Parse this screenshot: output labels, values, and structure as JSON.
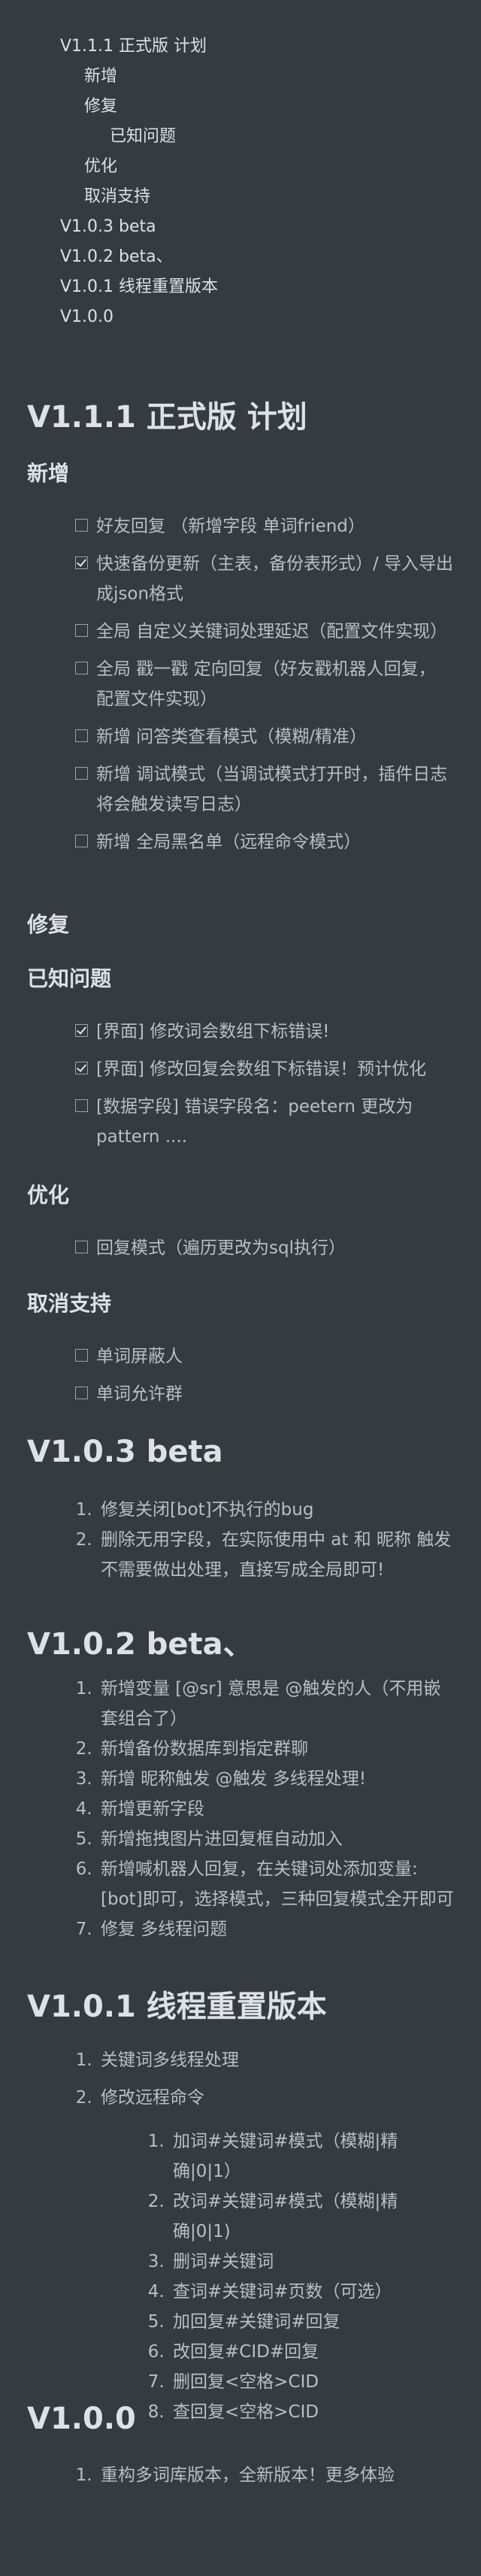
{
  "toc": [
    {
      "label": "V1.1.1 正式版 计划",
      "level": 1
    },
    {
      "label": "新增",
      "level": 2
    },
    {
      "label": "修复",
      "level": 2
    },
    {
      "label": "已知问题",
      "level": 3
    },
    {
      "label": "优化",
      "level": 2
    },
    {
      "label": "取消支持",
      "level": 2
    },
    {
      "label": "V1.0.3 beta",
      "level": 1
    },
    {
      "label": "V1.0.2 beta、",
      "level": 1
    },
    {
      "label": "V1.0.1 线程重置版本",
      "level": 1
    },
    {
      "label": "V1.0.0",
      "level": 1
    }
  ],
  "v111": {
    "title": "V1.1.1 正式版 计划",
    "added": {
      "heading": "新增",
      "items": [
        {
          "checked": false,
          "text": "好友回复 （新增字段 单词friend）"
        },
        {
          "checked": true,
          "text": "快速备份更新（主表，备份表形式）/ 导入导出成json格式"
        },
        {
          "checked": false,
          "text": "全局 自定义关键词处理延迟（配置文件实现）"
        },
        {
          "checked": false,
          "text": "全局 戳一戳 定向回复（好友戳机器人回复， 配置文件实现）"
        },
        {
          "checked": false,
          "text": "新增 问答类查看模式（模糊/精准）"
        },
        {
          "checked": false,
          "text": "新增 调试模式（当调试模式打开时，插件日志将会触发读写日志）"
        },
        {
          "checked": false,
          "text": "新增 全局黑名单（远程命令模式）"
        }
      ]
    },
    "fix": {
      "heading": "修复"
    },
    "known": {
      "heading": "已知问题",
      "items": [
        {
          "checked": true,
          "text": "[界面] 修改词会数组下标错误!"
        },
        {
          "checked": true,
          "text": "[界面] 修改回复会数组下标错误！预计优化"
        },
        {
          "checked": false,
          "text": "[数据字段] 错误字段名：peetern 更改为pattern ...."
        }
      ]
    },
    "optimize": {
      "heading": "优化",
      "items": [
        {
          "checked": false,
          "text": "回复模式（遍历更改为sql执行）"
        }
      ]
    },
    "cancel": {
      "heading": "取消支持",
      "items": [
        {
          "checked": false,
          "text": "单词屏蔽人"
        },
        {
          "checked": false,
          "text": "单词允许群"
        }
      ]
    }
  },
  "v103": {
    "title": "V1.0.3 beta",
    "items": [
      "修复关闭[bot]不执行的bug",
      "删除无用字段，在实际使用中 at 和 昵称 触发不需要做出处理，直接写成全局即可!"
    ]
  },
  "v102": {
    "title": "V1.0.2 beta、",
    "items": [
      "新增变量 [@sr] 意思是 @触发的人（不用嵌套组合了）",
      "新增备份数据库到指定群聊",
      "新增 昵称触发 @触发 多线程处理!",
      "新增更新字段",
      "新增拖拽图片进回复框自动加入",
      "新增喊机器人回复，在关键词处添加变量:[bot]即可，选择模式，三种回复模式全开即可",
      "修复 多线程问题"
    ]
  },
  "v101": {
    "title": "V1.0.1 线程重置版本",
    "items": [
      "关键词多线程处理",
      "修改远程命令"
    ],
    "sub_items": [
      "加词#关键词#模式（模糊|精确|0|1）",
      "改词#关键词#模式（模糊|精确|0|1)",
      "删词#关键词",
      "查词#关键词#页数（可选）",
      "加回复#关键词#回复",
      "改回复#CID#回复",
      "删回复<空格>CID",
      "查回复<空格>CID"
    ]
  },
  "v100": {
    "title": "V1.0.0",
    "items": [
      "重构多词库版本，全新版本！更多体验"
    ]
  }
}
